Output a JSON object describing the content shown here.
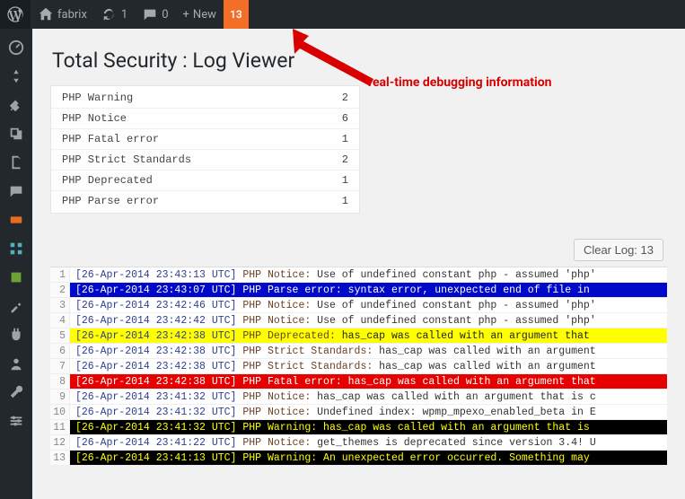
{
  "adminbar": {
    "site_name": "fabrix",
    "refresh_count": "1",
    "comments_count": "0",
    "new_label": "New",
    "new_plus": "+",
    "alert_count": "13"
  },
  "page": {
    "title": "Total Security : Log Viewer"
  },
  "summary": [
    {
      "label": "PHP Warning",
      "count": "2"
    },
    {
      "label": "PHP Notice",
      "count": "6"
    },
    {
      "label": "PHP Fatal error",
      "count": "1"
    },
    {
      "label": "PHP Strict Standards",
      "count": "2"
    },
    {
      "label": "PHP Deprecated",
      "count": "1"
    },
    {
      "label": "PHP Parse error",
      "count": "1"
    }
  ],
  "clear_label": "Clear Log: 13",
  "annotation": "real-time debugging information",
  "log": [
    {
      "n": "1",
      "ts": "[26-Apr-2014 23:43:13 UTC]",
      "lbl": "PHP Notice:",
      "msg": " Use of undefined constant php - assumed 'php'",
      "sev": "notice"
    },
    {
      "n": "2",
      "ts": "[26-Apr-2014 23:43:07 UTC]",
      "lbl": "PHP Parse error:",
      "msg": " syntax error, unexpected end of file in",
      "sev": "parse"
    },
    {
      "n": "3",
      "ts": "[26-Apr-2014 23:42:46 UTC]",
      "lbl": "PHP Notice:",
      "msg": " Use of undefined constant php - assumed 'php'",
      "sev": "notice"
    },
    {
      "n": "4",
      "ts": "[26-Apr-2014 23:42:42 UTC]",
      "lbl": "PHP Notice:",
      "msg": " Use of undefined constant php - assumed 'php'",
      "sev": "notice"
    },
    {
      "n": "5",
      "ts": "[26-Apr-2014 23:42:38 UTC]",
      "lbl": "PHP Deprecated:",
      "msg": " has_cap was called with an argument that",
      "sev": "deprecated"
    },
    {
      "n": "6",
      "ts": "[26-Apr-2014 23:42:38 UTC]",
      "lbl": "PHP Strict Standards:",
      "msg": " has_cap was called with an argument",
      "sev": "notice"
    },
    {
      "n": "7",
      "ts": "[26-Apr-2014 23:42:38 UTC]",
      "lbl": "PHP Strict Standards:",
      "msg": " has_cap was called with an argument",
      "sev": "notice"
    },
    {
      "n": "8",
      "ts": "[26-Apr-2014 23:42:38 UTC]",
      "lbl": "PHP Fatal error:",
      "msg": " has_cap was called with an argument that",
      "sev": "fatal"
    },
    {
      "n": "9",
      "ts": "[26-Apr-2014 23:41:32 UTC]",
      "lbl": "PHP Notice:",
      "msg": " has_cap was called with an argument that is c",
      "sev": "notice"
    },
    {
      "n": "10",
      "ts": "[26-Apr-2014 23:41:32 UTC]",
      "lbl": "PHP Notice:",
      "msg": " Undefined index: wpmp_mpexo_enabled_beta in E",
      "sev": "notice"
    },
    {
      "n": "11",
      "ts": "[26-Apr-2014 23:41:32 UTC]",
      "lbl": "PHP Warning:",
      "msg": " has_cap was called with an argument that is",
      "sev": "warning"
    },
    {
      "n": "12",
      "ts": "[26-Apr-2014 23:41:22 UTC]",
      "lbl": "PHP Notice:",
      "msg": " get_themes is deprecated since version 3.4! U",
      "sev": "notice"
    },
    {
      "n": "13",
      "ts": "[26-Apr-2014 23:41:13 UTC]",
      "lbl": "PHP Warning:",
      "msg": " An unexpected error occurred. Something may",
      "sev": "warning"
    }
  ]
}
